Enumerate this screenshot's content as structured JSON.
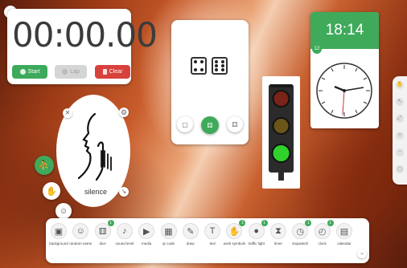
{
  "home": {
    "icon": "home-icon",
    "glyph": "⌂"
  },
  "stopwatch": {
    "time": "00:00.00",
    "start_label": "Start",
    "lap_label": "Lap",
    "clear_label": "Clear",
    "colors": {
      "start": "#3daa5b",
      "clear": "#d8423d",
      "lap": "#d5d5d5"
    }
  },
  "dice": {
    "values": [
      4,
      6
    ],
    "roll_badge": "⚄"
  },
  "clock": {
    "time": "18:14",
    "accent": "#3faa5a",
    "badge": "12"
  },
  "silence": {
    "label": "silence",
    "close": "✕",
    "gear": "⚙",
    "resize": "↘"
  },
  "toolbar": {
    "tools": [
      {
        "label": "background",
        "icon": "image-icon",
        "glyph": "▣",
        "badge": ""
      },
      {
        "label": "random name",
        "icon": "person-icon",
        "glyph": "☺",
        "badge": ""
      },
      {
        "label": "dice",
        "icon": "dice-icon",
        "glyph": "⚅",
        "badge": "1"
      },
      {
        "label": "sound level",
        "icon": "microphone-icon",
        "glyph": "♪",
        "badge": ""
      },
      {
        "label": "media",
        "icon": "media-icon",
        "glyph": "▶",
        "badge": ""
      },
      {
        "label": "qr code",
        "icon": "qr-icon",
        "glyph": "▦",
        "badge": ""
      },
      {
        "label": "draw",
        "icon": "pencil-icon",
        "glyph": "✎",
        "badge": ""
      },
      {
        "label": "text",
        "icon": "text-icon",
        "glyph": "T",
        "badge": ""
      },
      {
        "label": "work symbols",
        "icon": "symbols-icon",
        "glyph": "✋",
        "badge": "1"
      },
      {
        "label": "traffic light",
        "icon": "traffic-light-icon",
        "glyph": "●",
        "badge": "1"
      },
      {
        "label": "timer",
        "icon": "hourglass-icon",
        "glyph": "⧗",
        "badge": ""
      },
      {
        "label": "stopwatch",
        "icon": "stopwatch-icon",
        "glyph": "◷",
        "badge": "1"
      },
      {
        "label": "clock",
        "icon": "clock-icon",
        "glyph": "◴",
        "badge": "1"
      },
      {
        "label": "calendar",
        "icon": "calendar-icon",
        "glyph": "▤",
        "badge": ""
      }
    ],
    "chevron": "⌄"
  },
  "side_tools": [
    {
      "icon": "hand-icon",
      "glyph": "✋"
    },
    {
      "icon": "cursor-icon",
      "glyph": "↖"
    },
    {
      "icon": "expand-icon",
      "glyph": "⤢"
    },
    {
      "icon": "plus-icon",
      "glyph": "+"
    },
    {
      "icon": "minus-icon",
      "glyph": "−"
    },
    {
      "icon": "fit-icon",
      "glyph": "◻"
    }
  ]
}
